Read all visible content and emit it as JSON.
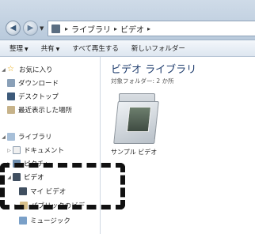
{
  "address": {
    "crumbs": [
      "ライブラリ",
      "ビデオ"
    ]
  },
  "toolbar": {
    "organize": "整理",
    "share": "共有",
    "play_all": "すべて再生する",
    "new_folder": "新しいフォルダー"
  },
  "navpane": {
    "favorites": "お気に入り",
    "downloads": "ダウンロード",
    "desktop": "デスクトップ",
    "recent": "最近表示した場所",
    "libraries": "ライブラリ",
    "documents": "ドキュメント",
    "pictures": "ピクチャ",
    "videos": "ビデオ",
    "my_videos": "マイ ビデオ",
    "public_videos": "パブリックのビデ",
    "music": "ミュージック"
  },
  "content": {
    "title": "ビデオ ライブラリ",
    "subtitle": "対象フォルダー: 2 か所",
    "item_label": "サンプル ビデオ"
  }
}
